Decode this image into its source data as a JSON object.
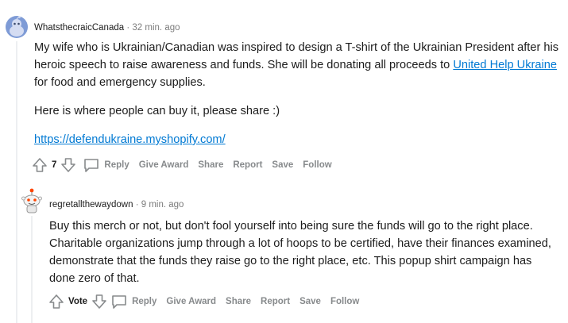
{
  "comments": [
    {
      "author": "WhatsthecraicCanada",
      "separator": "·",
      "time": "32 min. ago",
      "avatar_icon": "snoo-avatar-icon",
      "paragraph1_text": "My wife who is Ukrainian/Canadian was inspired to design a T-shirt of the Ukrainian President after his heroic speech to raise awareness and funds. She will be donating all proceeds to",
      "paragraph1_link": "United Help Ukraine",
      "paragraph1_tail": "for food and emergency supplies.",
      "paragraph2": "Here is where people can buy it, please share :)",
      "paragraph3_link": "https://defendukraine.myshopify.com/",
      "score": "7",
      "actions": {
        "reply": "Reply",
        "give_award": "Give Award",
        "share": "Share",
        "report": "Report",
        "save": "Save",
        "follow": "Follow"
      }
    },
    {
      "author": "regretallthewaydown",
      "separator": "·",
      "time": "9 min. ago",
      "avatar_icon": "snoo-avatar-icon",
      "text": "Buy this merch or not, but don't fool yourself into being sure the funds will go to the right place. Charitable organizations jump through a lot of hoops to be certified, have their finances examined, demonstrate that the funds they raise go to the right place, etc. This popup shirt campaign has done zero of that.",
      "score": "Vote",
      "actions": {
        "reply": "Reply",
        "give_award": "Give Award",
        "share": "Share",
        "report": "Report",
        "save": "Save",
        "follow": "Follow"
      }
    }
  ],
  "colors": {
    "link": "#0079d3",
    "meta": "#7c7c7c",
    "action": "#878a8c",
    "thread": "#edeff1"
  }
}
